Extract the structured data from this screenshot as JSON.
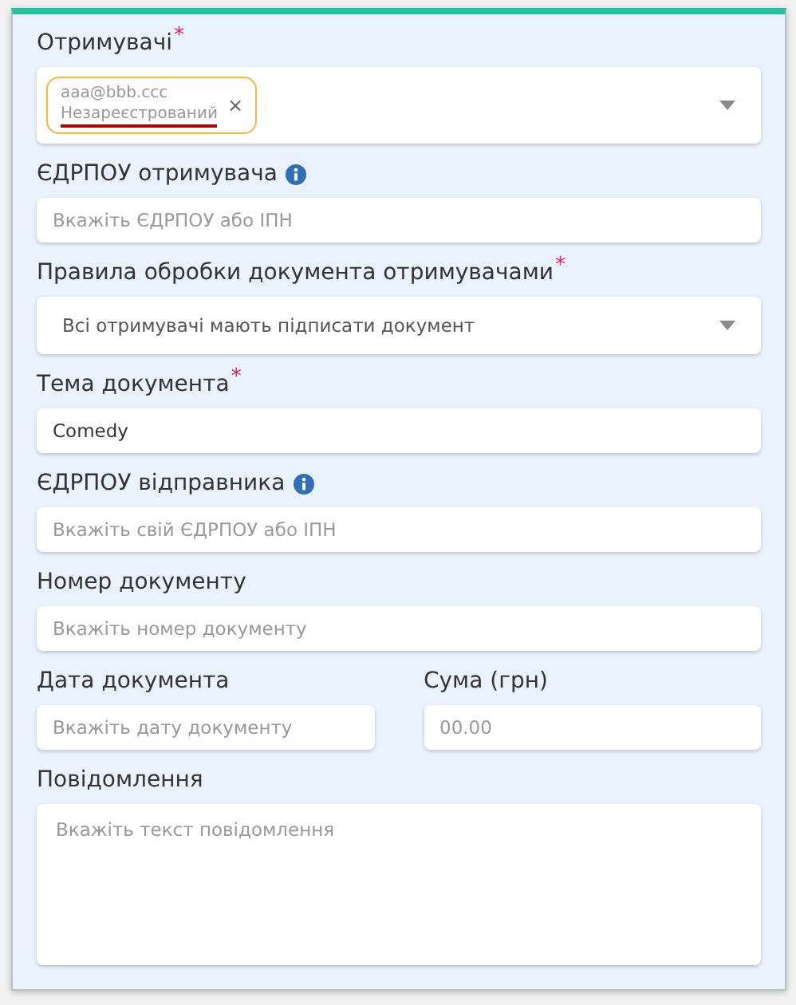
{
  "form": {
    "fields": [
      {
        "kind": "tags",
        "label": "Отримувачі",
        "required_mark": "*",
        "info": false,
        "tags": [
          {
            "email": "aaa@bbb.ccc",
            "status": "Незареєстрований",
            "removable": true,
            "label": "×"
          }
        ]
      },
      {
        "kind": "input",
        "label": "ЄДРПОУ отримувача",
        "info": true,
        "placeholder": "Вкажіть ЄДРПОУ або ІПН"
      },
      {
        "kind": "select",
        "label": "Правила обробки документа отримувачами",
        "required_mark": "*",
        "info": false,
        "value": "Всі отримувачі мають підписати документ"
      },
      {
        "kind": "input",
        "label": "Тема документа",
        "required_mark": "*",
        "info": false,
        "value": "Comedy"
      },
      {
        "kind": "input",
        "label": "ЄДРПОУ відправника",
        "info": true,
        "placeholder": "Вкажіть свій ЄДРПОУ або ІПН"
      },
      {
        "kind": "input",
        "label": "Номер документу",
        "info": false,
        "placeholder": "Вкажіть номер документу"
      },
      {
        "kind": "row",
        "fields": [
          {
            "kind": "input",
            "label": "Дата документа",
            "info": false,
            "placeholder": "Вкажіть дату документу"
          },
          {
            "kind": "input",
            "label": "Сума (грн)",
            "info": false,
            "placeholder": "00.00"
          }
        ]
      },
      {
        "kind": "textarea",
        "label": "Повідомлення",
        "info": false,
        "placeholder": "Вкажіть текст повідомлення"
      }
    ]
  }
}
